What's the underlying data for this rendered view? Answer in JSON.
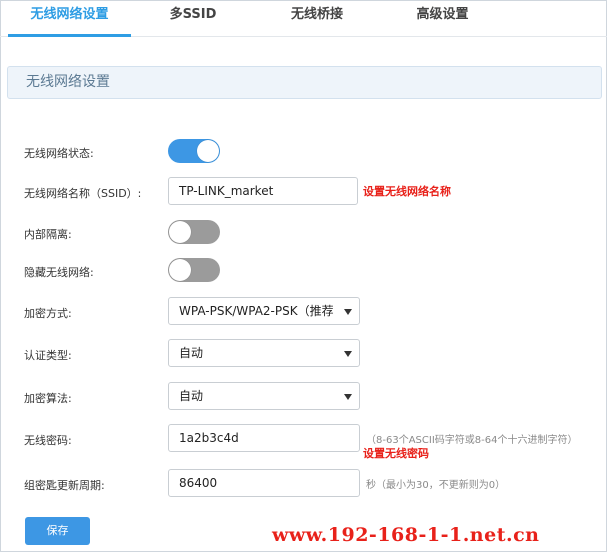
{
  "tabs": [
    "无线网络设置",
    "多SSID",
    "无线桥接",
    "高级设置"
  ],
  "section_title": "无线网络设置",
  "form": {
    "status_label": "无线网络状态:",
    "status_on": true,
    "ssid_label": "无线网络名称（SSID）:",
    "ssid_value": "TP-LINK_market",
    "ssid_note": "设置无线网络名称",
    "isolation_label": "内部隔离:",
    "isolation_on": false,
    "hide_label": "隐藏无线网络:",
    "hide_on": false,
    "encryption_label": "加密方式:",
    "encryption_value": "WPA-PSK/WPA2-PSK（推荐",
    "auth_label": "认证类型:",
    "auth_value": "自动",
    "algo_label": "加密算法:",
    "algo_value": "自动",
    "password_label": "无线密码:",
    "password_value": "1a2b3c4d",
    "password_hint": "（8-63个ASCII码字符或8-64个十六进制字符）",
    "password_note": "设置无线密码",
    "rekey_label": "组密匙更新周期:",
    "rekey_value": "86400",
    "rekey_hint": "秒（最小为30，不更新则为0）"
  },
  "save_label": "保存",
  "watermark": "www.192-168-1-1.net.cn",
  "colors": {
    "accent": "#3d97e4",
    "note": "#e8211a",
    "toggle_off": "#9b9b9b"
  }
}
